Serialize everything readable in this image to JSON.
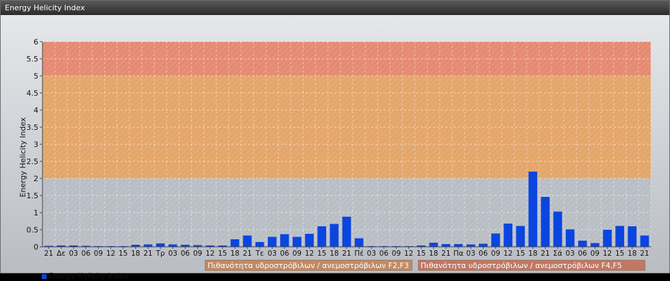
{
  "window": {
    "title": "Energy Helicity Index"
  },
  "chart_data": {
    "type": "bar",
    "ylabel": "Energy Helicity Index",
    "ylim": [
      0,
      6
    ],
    "yticks": [
      "0",
      "0.5",
      "1",
      "1.5",
      "2",
      "2.5",
      "3",
      "3.5",
      "4",
      "4.5",
      "5",
      "5.5",
      "6"
    ],
    "categories": [
      "21",
      "Δε",
      "03",
      "06",
      "09",
      "12",
      "15",
      "18",
      "21",
      "Τρ",
      "03",
      "06",
      "09",
      "12",
      "15",
      "18",
      "21",
      "Τε",
      "03",
      "06",
      "09",
      "12",
      "15",
      "18",
      "21",
      "Πέ",
      "03",
      "06",
      "09",
      "12",
      "15",
      "18",
      "21",
      "Πα",
      "03",
      "06",
      "09",
      "12",
      "15",
      "18",
      "21",
      "Σά",
      "03",
      "06",
      "09",
      "12",
      "15",
      "18",
      "21"
    ],
    "series": [
      {
        "name": "Energy Helicity Index",
        "color": "#0b45e0",
        "values": [
          0.03,
          0.04,
          0.04,
          0.03,
          0.02,
          0.02,
          0.02,
          0.06,
          0.07,
          0.1,
          0.07,
          0.06,
          0.05,
          0.04,
          0.04,
          0.22,
          0.33,
          0.14,
          0.29,
          0.37,
          0.29,
          0.38,
          0.6,
          0.67,
          0.88,
          0.25,
          0.02,
          0.02,
          0.02,
          0.02,
          0.04,
          0.12,
          0.08,
          0.08,
          0.07,
          0.09,
          0.39,
          0.68,
          0.61,
          2.2,
          1.46,
          1.03,
          0.51,
          0.18,
          0.11,
          0.5,
          0.61,
          0.6,
          0.33
        ]
      }
    ],
    "bands": [
      {
        "from": 0,
        "to": 2,
        "color": "#b9bec5"
      },
      {
        "from": 2,
        "to": 5,
        "color": "#e4a66a",
        "label": "Πιθανότητα υδροστρόβιλων / ανεμοστρόβιλων F2,F3"
      },
      {
        "from": 5,
        "to": 6,
        "color": "#e68a72",
        "label": "Πιθανότητα υδροστρόβιλων / ανεμοστρόβιλων F4,F5"
      }
    ],
    "grid": true,
    "legend_position": "bottom-left"
  }
}
